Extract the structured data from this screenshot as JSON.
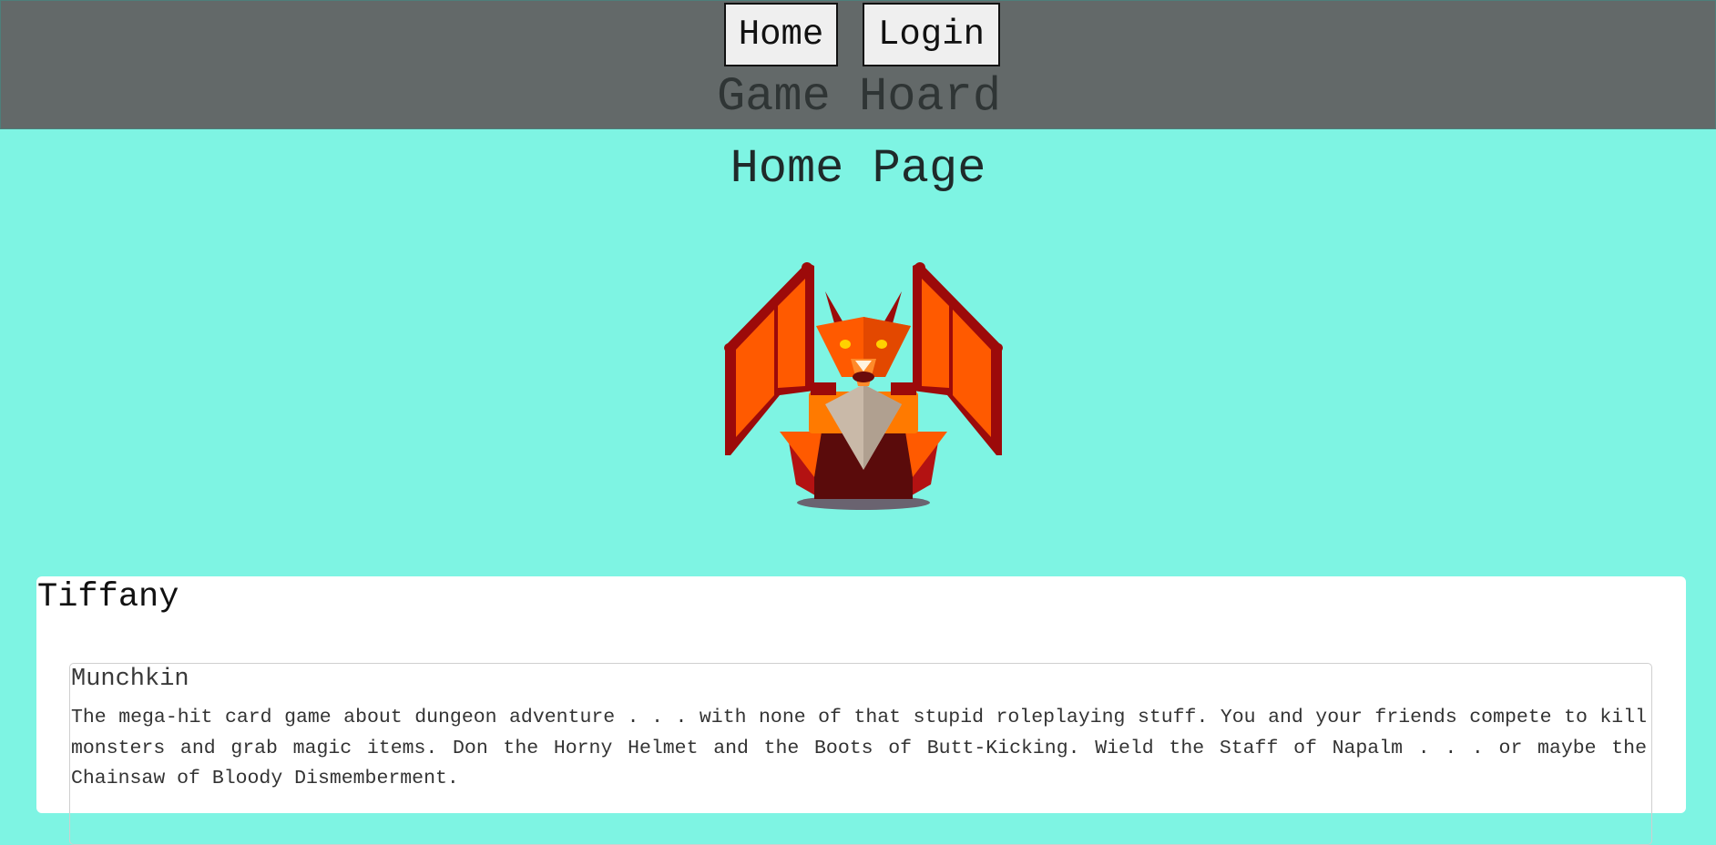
{
  "nav": {
    "home_label": "Home",
    "login_label": "Login"
  },
  "site": {
    "title": "Game Hoard"
  },
  "page": {
    "title": "Home Page",
    "image_icon": "dragon-icon"
  },
  "colors": {
    "background": "#7ef4e3",
    "navbar": "#636969",
    "card": "#ffffff"
  },
  "collection": {
    "owner": "Tiffany",
    "games": [
      {
        "title": "Munchkin",
        "description": "The mega-hit card game about dungeon adventure . . . with none of that stupid roleplaying stuff. You and your friends compete to kill monsters and grab magic items. Don the Horny Helmet and the Boots of Butt-Kicking. Wield the Staff of Napalm . . . or maybe the Chainsaw of Bloody Dismemberment."
      }
    ]
  }
}
